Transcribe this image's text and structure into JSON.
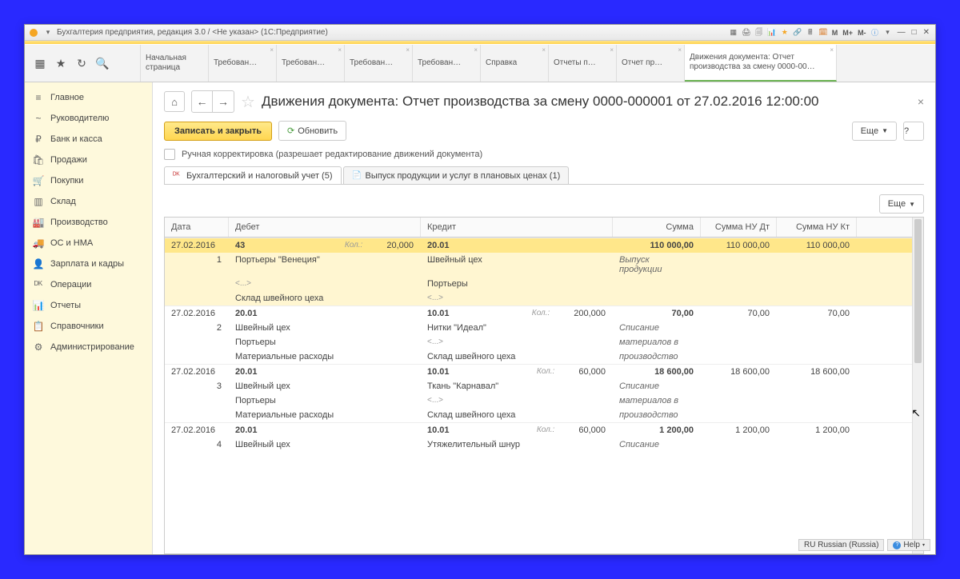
{
  "titlebar": {
    "title": "Бухгалтерия предприятия, редакция 3.0 / <Не указан>   (1С:Предприятие)",
    "m1": "M",
    "m2": "M+",
    "m3": "M-"
  },
  "top_tabs": [
    {
      "l1": "Начальная",
      "l2": "страница"
    },
    {
      "l1": "Требован…",
      "close": true
    },
    {
      "l1": "Требован…",
      "close": true
    },
    {
      "l1": "Требован…",
      "close": true
    },
    {
      "l1": "Требован…",
      "close": true
    },
    {
      "l1": "Справка",
      "close": true
    },
    {
      "l1": "Отчеты п…",
      "close": true
    },
    {
      "l1": "Отчет пр…",
      "close": true
    },
    {
      "l1": "Движения документа: Отчет",
      "l2": "производства за смену 0000-00…",
      "close": true,
      "active": true
    }
  ],
  "sidebar": [
    {
      "ic": "≡",
      "label": "Главное"
    },
    {
      "ic": "~",
      "label": "Руководителю"
    },
    {
      "ic": "₽",
      "label": "Банк и касса"
    },
    {
      "ic": "🛍",
      "label": "Продажи"
    },
    {
      "ic": "🛒",
      "label": "Покупки"
    },
    {
      "ic": "▥",
      "label": "Склад"
    },
    {
      "ic": "🏭",
      "label": "Производство"
    },
    {
      "ic": "🚚",
      "label": "ОС и НМА"
    },
    {
      "ic": "👤",
      "label": "Зарплата и кадры"
    },
    {
      "ic": "ᴰᴷ",
      "label": "Операции"
    },
    {
      "ic": "📊",
      "label": "Отчеты"
    },
    {
      "ic": "📋",
      "label": "Справочники"
    },
    {
      "ic": "⚙",
      "label": "Администрирование"
    }
  ],
  "doc": {
    "title": "Движения документа: Отчет производства за смену 0000-000001 от 27.02.2016 12:00:00",
    "save": "Записать и закрыть",
    "refresh": "Обновить",
    "more": "Еще",
    "help": "?",
    "manual_label": "Ручная корректировка (разрешает редактирование движений документа)"
  },
  "tabs2": [
    {
      "label": "Бухгалтерский и налоговый учет (5)",
      "active": true
    },
    {
      "label": "Выпуск продукции и услуг в плановых ценах (1)"
    }
  ],
  "grid": {
    "more": "Еще",
    "hdr": {
      "date": "Дата",
      "debit": "Дебет",
      "credit": "Кредит",
      "sum": "Сумма",
      "nudt": "Сумма НУ Дт",
      "nukt": "Сумма НУ Кт"
    },
    "qty_label": "Кол.:",
    "rows": [
      {
        "sel": true,
        "date": "27.02.2016",
        "n": "1",
        "debit": [
          "43",
          "Портьеры \"Венеция\"",
          "<...>",
          "Склад швейного цеха"
        ],
        "credit": [
          "20.01",
          "Швейный цех",
          "Портьеры",
          "<...>"
        ],
        "qty_d": "20,000",
        "qty_c": "",
        "sum": "110 000,00",
        "nudt": "110 000,00",
        "nukt": "110 000,00",
        "note": "Выпуск продукции"
      },
      {
        "date": "27.02.2016",
        "n": "2",
        "debit": [
          "20.01",
          "Швейный цех",
          "Портьеры",
          "Материальные расходы"
        ],
        "credit": [
          "10.01",
          "Нитки \"Идеал\"",
          "<...>",
          "Склад швейного цеха"
        ],
        "qty_d": "",
        "qty_c": "200,000",
        "sum": "70,00",
        "nudt": "70,00",
        "nukt": "70,00",
        "note": "Списание материалов в производство"
      },
      {
        "date": "27.02.2016",
        "n": "3",
        "debit": [
          "20.01",
          "Швейный цех",
          "Портьеры",
          "Материальные расходы"
        ],
        "credit": [
          "10.01",
          "Ткань \"Карнавал\"",
          "<...>",
          "Склад швейного цеха"
        ],
        "qty_d": "",
        "qty_c": "60,000",
        "sum": "18 600,00",
        "nudt": "18 600,00",
        "nukt": "18 600,00",
        "note": "Списание материалов в производство"
      },
      {
        "date": "27.02.2016",
        "n": "4",
        "debit": [
          "20.01",
          "Швейный цех"
        ],
        "credit": [
          "10.01",
          "Утяжелительный шнур"
        ],
        "qty_d": "",
        "qty_c": "60,000",
        "sum": "1 200,00",
        "nudt": "1 200,00",
        "nukt": "1 200,00",
        "note": "Списание"
      }
    ]
  },
  "status": {
    "lang": "RU Russian (Russia)",
    "help": "Help"
  }
}
